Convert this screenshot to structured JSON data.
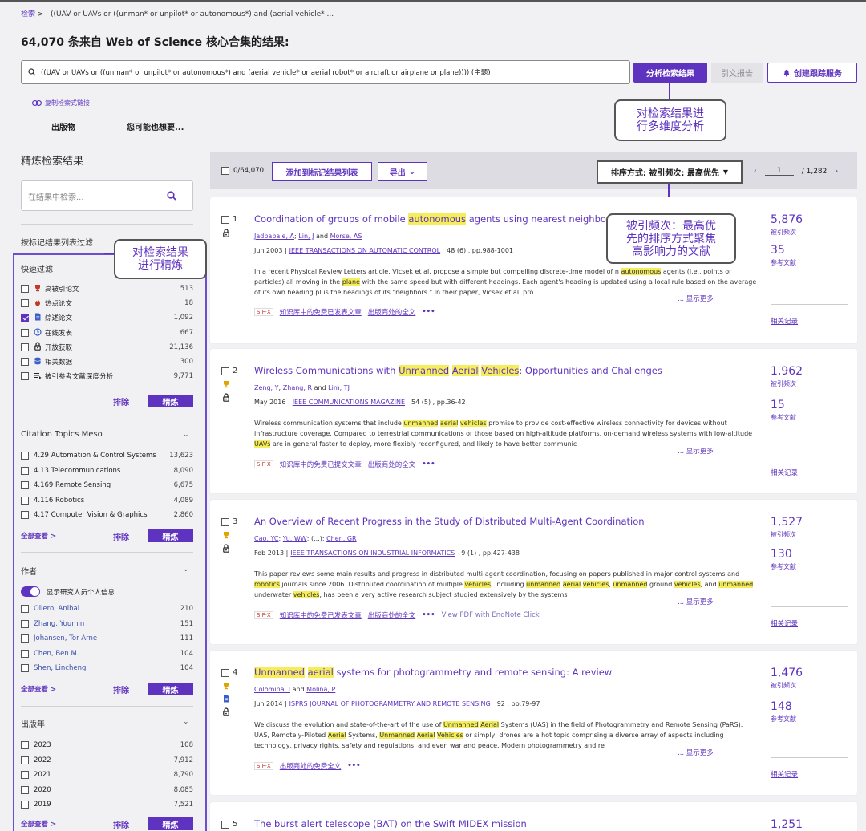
{
  "breadcrumb": {
    "root": "检索",
    "sep": ">",
    "query": "((UAV or UAVs or ((unman* or unpilot* or autonomous*) and (aerial vehicle* ..."
  },
  "result_title": "64,070 条来自 Web of Science 核心合集的结果:",
  "search": {
    "query": "((UAV or UAVs or ((unman* or unpilot* or autonomous*) and (aerial vehicle* or aerial robot* or aircraft or airplane or plane)))) (主题)"
  },
  "toolbar": {
    "analyze": "分析检索结果",
    "cite_report": "引文报告",
    "track": "创建跟踪服务"
  },
  "copy_link": "复制检索式链接",
  "tabs": {
    "pub": "出版物",
    "like": "您可能也想要..."
  },
  "callouts": {
    "analyze": "对检索结果进\n行多维度分析",
    "sort": "被引频次：最高优\n先的排序方式聚焦\n高影响力的文献",
    "refine": "对检索结果\n进行精炼"
  },
  "refine": {
    "title": "精炼检索结果",
    "search_placeholder": "在结果中检索...",
    "filter_label": "按标记结果列表过滤"
  },
  "quick": {
    "title": "快速过滤",
    "items": [
      {
        "label": "高被引论文",
        "count": "513",
        "icon": "trophy-icon",
        "color": "#c0392b",
        "checked": false
      },
      {
        "label": "热点论文",
        "count": "18",
        "icon": "fire-icon",
        "color": "#c0392b",
        "checked": false
      },
      {
        "label": "综述论文",
        "count": "1,092",
        "icon": "document-icon",
        "color": "#3a5fc8",
        "checked": true
      },
      {
        "label": "在线发表",
        "count": "667",
        "icon": "clock-icon",
        "color": "#3a5fc8",
        "checked": false
      },
      {
        "label": "开放获取",
        "count": "21,136",
        "icon": "lock-icon",
        "color": "#222222",
        "checked": false
      },
      {
        "label": "相关数据",
        "count": "300",
        "icon": "database-icon",
        "color": "#3a5fc8",
        "checked": false
      },
      {
        "label": "被引参考文献深度分析",
        "count": "9,771",
        "icon": "list-icon",
        "color": "#222222",
        "checked": false
      }
    ],
    "exclude": "排除",
    "refine": "精炼"
  },
  "topics": {
    "title": "Citation Topics Meso",
    "items": [
      {
        "label": "4.29 Automation & Control Systems",
        "count": "13,623"
      },
      {
        "label": "4.13 Telecommunications",
        "count": "8,090"
      },
      {
        "label": "4.169 Remote Sensing",
        "count": "6,675"
      },
      {
        "label": "4.116 Robotics",
        "count": "4,089"
      },
      {
        "label": "4.17 Computer Vision & Graphics",
        "count": "2,860"
      }
    ],
    "all": "全部查看 >",
    "exclude": "排除",
    "refine": "精炼"
  },
  "authors": {
    "title": "作者",
    "toggle": "显示研究人员个人信息",
    "items": [
      {
        "label": "Ollero, Anibal",
        "count": "210"
      },
      {
        "label": "Zhang, Youmin",
        "count": "151"
      },
      {
        "label": "Johansen, Tor Arne",
        "count": "111"
      },
      {
        "label": "Chen, Ben M.",
        "count": "104"
      },
      {
        "label": "Shen, Lincheng",
        "count": "104"
      }
    ],
    "all": "全部查看 >",
    "exclude": "排除",
    "refine": "精炼"
  },
  "years": {
    "title": "出版年",
    "items": [
      {
        "label": "2023",
        "count": "108"
      },
      {
        "label": "2022",
        "count": "7,912"
      },
      {
        "label": "2021",
        "count": "8,790"
      },
      {
        "label": "2020",
        "count": "8,085"
      },
      {
        "label": "2019",
        "count": "7,521"
      }
    ],
    "all": "全部查看 >",
    "exclude": "排除",
    "refine": "精炼"
  },
  "results_bar": {
    "selected": "0/64,070",
    "add_mark": "添加到标记结果列表",
    "export": "导出",
    "sort": "排序方式: 被引频次: 最高优先",
    "page": "1",
    "pages": "/ 1,282"
  },
  "labels": {
    "cites": "被引频次",
    "refs": "参考文献",
    "related": "相关记录",
    "more": "... 显示更多",
    "sfx": "S·F·X",
    "dots": "•••"
  },
  "results": [
    {
      "num": "1",
      "title": [
        [
          "Coordination of groups of mobile ",
          false
        ],
        [
          "autonomous",
          true
        ],
        [
          " agents using nearest neighbor rules",
          false
        ]
      ],
      "authors": [
        [
          "Jadbabaie, A",
          true
        ],
        [
          "; ",
          false
        ],
        [
          "Lin, J",
          true
        ],
        [
          " and ",
          false
        ],
        [
          "Morse, AS",
          true
        ]
      ],
      "date": "Jun 2003 |",
      "journal": "IEEE TRANSACTIONS ON AUTOMATIC CONTROL",
      "vol": "48 (6) , pp.988-1001",
      "abstract": [
        [
          "In a recent Physical Review Letters article, Vicsek et al. propose a simple but compelling discrete-time model of n ",
          false
        ],
        [
          "autonomous",
          true
        ],
        [
          " agents (i.e., points or particles) all moving in the ",
          false
        ],
        [
          "plane",
          true
        ],
        [
          " with the same speed but with different headings. Each agent's heading is updated using a local rule based on the average of its own heading plus the headings of its \"neighbors.\" In their paper, Vicsek et al. pro",
          false
        ]
      ],
      "links": [
        "知识库中的免费已发表文章",
        "出版商处的全文"
      ],
      "pdf": "",
      "cites": "5,876",
      "refs": "35",
      "icons": [
        "lock-icon"
      ]
    },
    {
      "num": "2",
      "title": [
        [
          "Wireless Communications with ",
          false
        ],
        [
          "Unmanned",
          true
        ],
        [
          " ",
          false
        ],
        [
          "Aerial",
          true
        ],
        [
          " ",
          false
        ],
        [
          "Vehicles",
          true
        ],
        [
          ": Opportunities and Challenges",
          false
        ]
      ],
      "authors": [
        [
          "Zeng, Y",
          true
        ],
        [
          "; ",
          false
        ],
        [
          "Zhang, R",
          true
        ],
        [
          " and ",
          false
        ],
        [
          "Lim, TJ",
          true
        ]
      ],
      "date": "May 2016 |",
      "journal": "IEEE COMMUNICATIONS MAGAZINE",
      "vol": "54 (5) , pp.36-42",
      "abstract": [
        [
          "Wireless communication systems that include ",
          false
        ],
        [
          "unmanned",
          true
        ],
        [
          " ",
          false
        ],
        [
          "aerial",
          true
        ],
        [
          " ",
          false
        ],
        [
          "vehicles",
          true
        ],
        [
          " promise to provide cost-effective wireless connectivity for devices without infrastructure coverage. Compared to terrestrial communications or those based on high-altitude platforms, on-demand wireless systems with low-altitude ",
          false
        ],
        [
          "UAVs",
          true
        ],
        [
          " are in general faster to deploy, more flexibly reconfigured, and likely to have better communic",
          false
        ]
      ],
      "links": [
        "知识库中的免费已提交文章",
        "出版商处的全文"
      ],
      "pdf": "",
      "cites": "1,962",
      "refs": "15",
      "icons": [
        "trophy-icon",
        "lock-icon"
      ]
    },
    {
      "num": "3",
      "title": [
        [
          "An Overview of Recent Progress in the Study of Distributed Multi-Agent Coordination",
          false
        ]
      ],
      "authors": [
        [
          "Cao, YC",
          true
        ],
        [
          "; ",
          false
        ],
        [
          "Yu, WW",
          true
        ],
        [
          "; (...); ",
          false
        ],
        [
          "Chen, GR",
          true
        ]
      ],
      "date": "Feb 2013 |",
      "journal": "IEEE TRANSACTIONS ON INDUSTRIAL INFORMATICS",
      "vol": "9 (1) , pp.427-438",
      "abstract": [
        [
          "This paper reviews some main results and progress in distributed multi-agent coordination, focusing on papers published in major control systems and ",
          false
        ],
        [
          "robotics",
          true
        ],
        [
          " journals since 2006. Distributed coordination of multiple ",
          false
        ],
        [
          "vehicles",
          true
        ],
        [
          ", including ",
          false
        ],
        [
          "unmanned",
          true
        ],
        [
          " ",
          false
        ],
        [
          "aerial",
          true
        ],
        [
          " ",
          false
        ],
        [
          "vehicles",
          true
        ],
        [
          ", ",
          false
        ],
        [
          "unmanned",
          true
        ],
        [
          " ground ",
          false
        ],
        [
          "vehicles",
          true
        ],
        [
          ", and ",
          false
        ],
        [
          "unmanned",
          true
        ],
        [
          " underwater ",
          false
        ],
        [
          "vehicles",
          true
        ],
        [
          ", has been a very active research subject studied extensively by the systems",
          false
        ]
      ],
      "links": [
        "知识库中的免费已发表文章",
        "出版商处的全文"
      ],
      "pdf": "View PDF with EndNote Click",
      "cites": "1,527",
      "refs": "130",
      "icons": [
        "trophy-icon",
        "lock-icon"
      ]
    },
    {
      "num": "4",
      "title": [
        [
          "Unmanned",
          true
        ],
        [
          " ",
          false
        ],
        [
          "aerial",
          true
        ],
        [
          " systems for photogrammetry and remote sensing: A review",
          false
        ]
      ],
      "authors": [
        [
          "Colomina, I",
          true
        ],
        [
          " and ",
          false
        ],
        [
          "Molina, P",
          true
        ]
      ],
      "date": "Jun 2014 |",
      "journal": "ISPRS JOURNAL OF PHOTOGRAMMETRY AND REMOTE SENSING",
      "vol": "92 , pp.79-97",
      "abstract": [
        [
          "We discuss the evolution and state-of-the-art of the use of ",
          false
        ],
        [
          "Unmanned",
          true
        ],
        [
          " ",
          false
        ],
        [
          "Aerial",
          true
        ],
        [
          " Systems (UAS) in the field of Photogrammetry and Remote Sensing (PaRS). UAS, Remotely-Piloted ",
          false
        ],
        [
          "Aerial",
          true
        ],
        [
          " Systems, ",
          false
        ],
        [
          "Unmanned",
          true
        ],
        [
          " ",
          false
        ],
        [
          "Aerial",
          true
        ],
        [
          " ",
          false
        ],
        [
          "Vehicles",
          true
        ],
        [
          " or simply, drones are a hot topic comprising a diverse array of aspects including technology, privacy rights, safety and regulations, and even war and peace. Modern photogrammetry and re",
          false
        ]
      ],
      "links": [
        "出版商处的免费全文"
      ],
      "pdf": "",
      "cites": "1,476",
      "refs": "148",
      "icons": [
        "trophy-icon",
        "document-icon",
        "lock-icon"
      ]
    },
    {
      "num": "5",
      "title": [
        [
          "The burst alert telescope (BAT) on the Swift MIDEX mission",
          false
        ]
      ],
      "cites": "1,251"
    }
  ]
}
